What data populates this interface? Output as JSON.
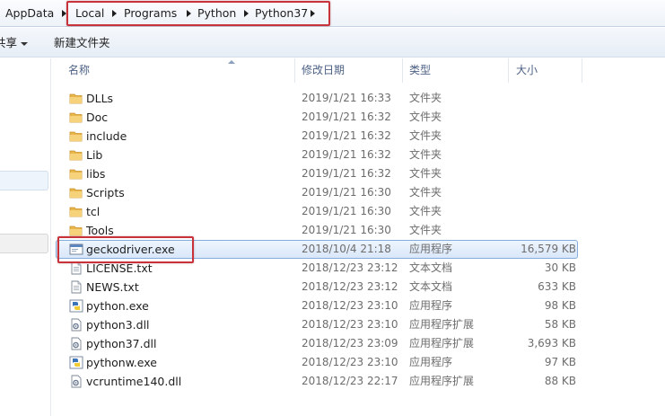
{
  "address_bar": {
    "segments": [
      "AppData",
      "Local",
      "Programs",
      "Python",
      "Python37"
    ]
  },
  "toolbar": {
    "share_label": "共享",
    "new_folder_label": "新建文件夹"
  },
  "columns": {
    "name": "名称",
    "date": "修改日期",
    "type": "类型",
    "size": "大小"
  },
  "files": [
    {
      "name": "DLLs",
      "date": "2019/1/21 16:33",
      "type": "文件夹",
      "size": "",
      "icon": "folder-icon"
    },
    {
      "name": "Doc",
      "date": "2019/1/21 16:32",
      "type": "文件夹",
      "size": "",
      "icon": "folder-icon"
    },
    {
      "name": "include",
      "date": "2019/1/21 16:32",
      "type": "文件夹",
      "size": "",
      "icon": "folder-icon"
    },
    {
      "name": "Lib",
      "date": "2019/1/21 16:32",
      "type": "文件夹",
      "size": "",
      "icon": "folder-icon"
    },
    {
      "name": "libs",
      "date": "2019/1/21 16:32",
      "type": "文件夹",
      "size": "",
      "icon": "folder-icon"
    },
    {
      "name": "Scripts",
      "date": "2019/1/21 16:30",
      "type": "文件夹",
      "size": "",
      "icon": "folder-icon"
    },
    {
      "name": "tcl",
      "date": "2019/1/21 16:30",
      "type": "文件夹",
      "size": "",
      "icon": "folder-icon"
    },
    {
      "name": "Tools",
      "date": "2019/1/21 16:30",
      "type": "文件夹",
      "size": "",
      "icon": "folder-icon"
    },
    {
      "name": "geckodriver.exe",
      "date": "2018/10/4 21:18",
      "type": "应用程序",
      "size": "16,579 KB",
      "icon": "exe-window-icon"
    },
    {
      "name": "LICENSE.txt",
      "date": "2018/12/23 23:12",
      "type": "文本文档",
      "size": "30 KB",
      "icon": "text-document-icon"
    },
    {
      "name": "NEWS.txt",
      "date": "2018/12/23 23:12",
      "type": "文本文档",
      "size": "633 KB",
      "icon": "text-document-icon"
    },
    {
      "name": "python.exe",
      "date": "2018/12/23 23:10",
      "type": "应用程序",
      "size": "98 KB",
      "icon": "python-icon"
    },
    {
      "name": "python3.dll",
      "date": "2018/12/23 23:10",
      "type": "应用程序扩展",
      "size": "58 KB",
      "icon": "dll-gear-icon"
    },
    {
      "name": "python37.dll",
      "date": "2018/12/23 23:09",
      "type": "应用程序扩展",
      "size": "3,693 KB",
      "icon": "dll-gear-icon"
    },
    {
      "name": "pythonw.exe",
      "date": "2018/12/23 23:10",
      "type": "应用程序",
      "size": "97 KB",
      "icon": "python-icon"
    },
    {
      "name": "vcruntime140.dll",
      "date": "2018/12/23 22:17",
      "type": "应用程序扩展",
      "size": "88 KB",
      "icon": "dll-gear-icon"
    }
  ],
  "colors": {
    "highlight_annotation": "#c8323a",
    "selection": "#84acdd",
    "header_text": "#4d6185",
    "folder": "#e8b64a"
  }
}
